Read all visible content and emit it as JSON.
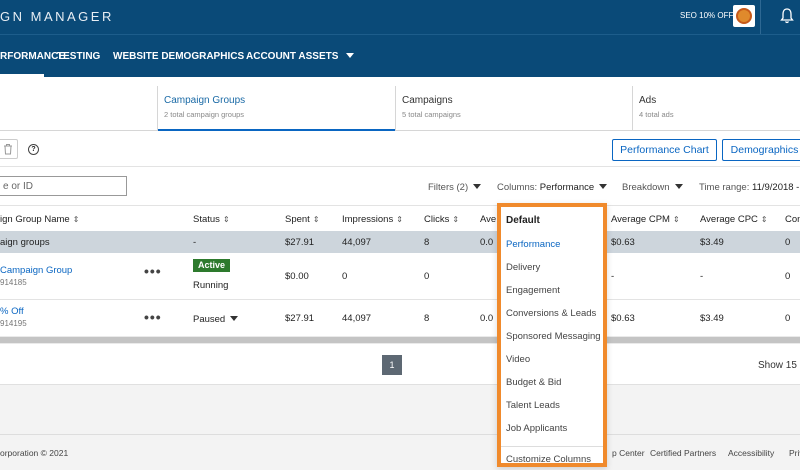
{
  "header": {
    "brand": "GN MANAGER",
    "account_label": "SEO 10% OFF"
  },
  "nav": {
    "items": [
      "RFORMANCE",
      "TESTING",
      "WEBSITE DEMOGRAPHICS",
      "ACCOUNT ASSETS"
    ]
  },
  "tabs": [
    {
      "title": "",
      "subtitle": ""
    },
    {
      "title": "Campaign Groups",
      "subtitle": "2 total campaign groups"
    },
    {
      "title": "Campaigns",
      "subtitle": "5 total campaigns"
    },
    {
      "title": "Ads",
      "subtitle": "4 total ads"
    }
  ],
  "toolbar": {
    "help": "?",
    "performance_chart": "Performance Chart",
    "demographics": "Demographics"
  },
  "filters": {
    "search_placeholder": "e or ID",
    "filters_label": "Filters (2)",
    "columns_label": "Columns:",
    "columns_value": "Performance",
    "breakdown_label": "Breakdown",
    "time_range_label": "Time range:",
    "time_range_value": "11/9/2018 - "
  },
  "table": {
    "headers": [
      "ign Group Name",
      "Status",
      "Spent",
      "Impressions",
      "Clicks",
      "Ave",
      "Average CPM",
      "Average CPC",
      "Con"
    ],
    "totals": {
      "name": "aign groups",
      "status": "-",
      "spent": "$27.91",
      "impressions": "44,097",
      "clicks": "8",
      "avg": "0.0",
      "cpm": "$0.63",
      "cpc": "$3.49",
      "conv": "0"
    },
    "rows": [
      {
        "name": "Campaign Group",
        "id": "914185",
        "status_badge": "Active",
        "status_text": "Running",
        "spent": "$0.00",
        "impressions": "0",
        "clicks": "0",
        "avg": "",
        "cpm": "-",
        "cpc": "-",
        "conv": "0"
      },
      {
        "name": "% Off",
        "id": "914195",
        "status_text": "Paused",
        "spent": "$27.91",
        "impressions": "44,097",
        "clicks": "8",
        "avg": "0.0",
        "cpm": "$0.63",
        "cpc": "$3.49",
        "conv": "0"
      }
    ],
    "more": "•••"
  },
  "pagination": {
    "page": "1",
    "show": "Show 15"
  },
  "footer": {
    "copyright": "orporation © 2021",
    "links": [
      "p Center",
      "Certified Partners",
      "Accessibility",
      "Priv"
    ]
  },
  "columns_menu": {
    "items": [
      "Default",
      "Performance",
      "Delivery",
      "Engagement",
      "Conversions & Leads",
      "Sponsored Messaging",
      "Video",
      "Budget & Bid",
      "Talent Leads",
      "Job Applicants"
    ],
    "customize": "Customize Columns"
  },
  "colors": {
    "header_bg": "#0a4a78",
    "accent": "#0a66c2",
    "highlight_border": "#f08a2c",
    "active_badge": "#2d7a2d"
  },
  "icons": [
    "bell-icon",
    "trash-icon",
    "help-icon",
    "sort-icon",
    "caret-down-icon",
    "more-icon"
  ]
}
